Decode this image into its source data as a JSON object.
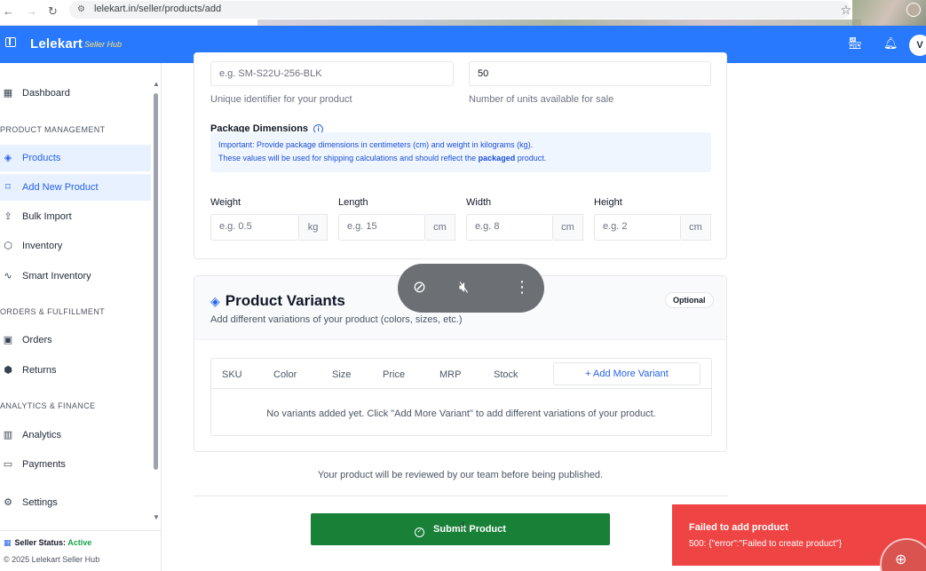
{
  "browser": {
    "url": "lelekart.in/seller/products/add"
  },
  "header": {
    "brand": "Lelekart",
    "subtitle": "Seller Hub",
    "avatar_initial": "V",
    "accent": "#2979ff"
  },
  "sidebar": {
    "items": [
      {
        "label": "Dashboard",
        "icon": "grid-icon"
      },
      {
        "section": "PRODUCT MANAGEMENT"
      },
      {
        "label": "Products",
        "icon": "layers-icon",
        "active": true
      },
      {
        "label": "Add New Product",
        "icon": "bookmark-icon",
        "active": true
      },
      {
        "label": "Bulk Import",
        "icon": "upload-icon"
      },
      {
        "label": "Inventory",
        "icon": "box-icon"
      },
      {
        "label": "Smart Inventory",
        "icon": "activity-icon"
      },
      {
        "section": "ORDERS & FULFILLMENT"
      },
      {
        "label": "Orders",
        "icon": "package-icon"
      },
      {
        "label": "Returns",
        "icon": "return-icon"
      },
      {
        "section": "ANALYTICS & FINANCE"
      },
      {
        "label": "Analytics",
        "icon": "bar-chart-icon"
      },
      {
        "label": "Payments",
        "icon": "card-icon"
      },
      {
        "label": "Settings",
        "icon": "gear-icon"
      }
    ],
    "seller_status_label": "Seller Status:",
    "seller_status_value": "Active",
    "copyright": "© 2025 Lelekart Seller Hub"
  },
  "form": {
    "sku_placeholder": "e.g. SM-S22U-256-BLK",
    "sku_help": "Unique identifier for your product",
    "stock_value": "50",
    "stock_help": "Number of units available for sale",
    "package_dimensions_label": "Package Dimensions",
    "notice_line1": "Important: Provide package dimensions in centimeters (cm) and weight in kilograms (kg).",
    "notice_line2_pre": "These values will be used for shipping calculations and should reflect the ",
    "notice_line2_bold": "packaged",
    "notice_line2_post": " product.",
    "dims": [
      {
        "label": "Weight",
        "placeholder": "e.g. 0.5",
        "unit": "kg"
      },
      {
        "label": "Length",
        "placeholder": "e.g. 15",
        "unit": "cm"
      },
      {
        "label": "Width",
        "placeholder": "e.g. 8",
        "unit": "cm"
      },
      {
        "label": "Height",
        "placeholder": "e.g. 2",
        "unit": "cm"
      }
    ]
  },
  "variants": {
    "title": "Product Variants",
    "subtitle": "Add different variations of your product (colors, sizes, etc.)",
    "badge": "Optional",
    "columns": [
      "SKU",
      "Color",
      "Size",
      "Price",
      "MRP",
      "Stock"
    ],
    "add_button": "+ Add More Variant",
    "empty_text": "No variants added yet. Click \"Add More Variant\" to add different variations of your product."
  },
  "footer": {
    "review_note": "Your product will be reviewed by our team before being published.",
    "submit_label": "Submit Product",
    "submit_color": "#198038"
  },
  "toast": {
    "title": "Failed to add product",
    "message": "500: {\"error\":\"Failed to create product\"}",
    "color": "#ef4444"
  },
  "media_overlay": {
    "icons": [
      "pin-off-icon",
      "volume-mute-icon",
      "more-vertical-icon"
    ]
  }
}
